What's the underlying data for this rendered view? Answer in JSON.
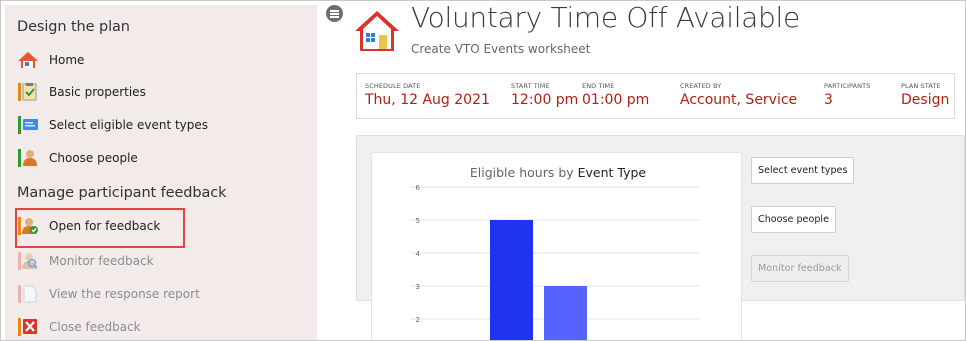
{
  "sidebar": {
    "section_design": "Design the plan",
    "section_manage": "Manage participant feedback",
    "items": [
      {
        "label": "Home",
        "icon": "home-icon"
      },
      {
        "label": "Basic properties",
        "icon": "clipboard-check-icon"
      },
      {
        "label": "Select eligible event types",
        "icon": "monitor-list-icon"
      },
      {
        "label": "Choose people",
        "icon": "person-icon"
      },
      {
        "label": "Open for feedback",
        "icon": "person-check-icon"
      },
      {
        "label": "Monitor feedback",
        "icon": "person-search-icon",
        "disabled": true
      },
      {
        "label": "View the response report",
        "icon": "document-icon",
        "disabled": true
      },
      {
        "label": "Close feedback",
        "icon": "close-x-icon",
        "disabled": true
      }
    ]
  },
  "header": {
    "title": "Voluntary Time Off Available",
    "subtitle": "Create VTO Events worksheet"
  },
  "info": {
    "schedule_date_label": "SCHEDULE DATE",
    "schedule_date": "Thu, 12 Aug 2021",
    "start_time_label": "START TIME",
    "start_time": "12:00 pm",
    "end_time_label": "END TIME",
    "end_time": "01:00 pm",
    "created_by_label": "CREATED BY",
    "created_by": "Account, Service",
    "participants_label": "PARTICIPANTS",
    "participants": "3",
    "plan_state_label": "PLAN STATE",
    "plan_state": "Design"
  },
  "buttons": {
    "select_event_types": "Select event types",
    "choose_people": "Choose people",
    "monitor_feedback": "Monitor feedback"
  },
  "colors": {
    "accent_value": "#b2200f",
    "highlight": "#e04444",
    "sidebar_bg": "#f3eaea"
  },
  "chart_data": {
    "type": "bar",
    "title_prefix": "Eligible hours by ",
    "title_emphasis": "Event Type",
    "y_ticks": [
      2,
      3,
      4,
      5,
      6
    ],
    "series": [
      {
        "values": [
          5
        ],
        "color": "#1f33f0"
      },
      {
        "values": [
          3
        ],
        "color": "#5563ff"
      }
    ],
    "ylim_visible": [
      1.1,
      6
    ]
  }
}
